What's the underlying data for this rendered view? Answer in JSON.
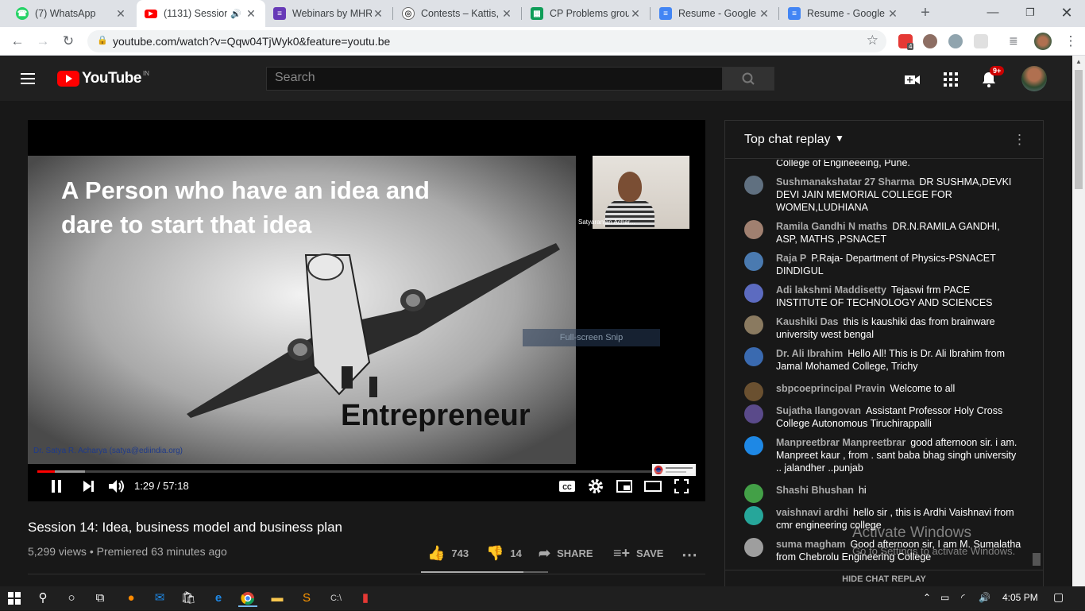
{
  "browser": {
    "tabs": [
      {
        "title": "(7) WhatsApp",
        "icon": "whatsapp-icon",
        "color": "#25d366",
        "active": false
      },
      {
        "title": "(1131) Session",
        "icon": "youtube-icon",
        "color": "#ff0000",
        "active": true
      },
      {
        "title": "Webinars by MHR",
        "icon": "forms-icon",
        "color": "#673ab7",
        "active": false
      },
      {
        "title": "Contests – Kattis,",
        "icon": "kattis-icon",
        "color": "#444444",
        "active": false
      },
      {
        "title": "CP Problems grou",
        "icon": "sheets-icon",
        "color": "#0f9d58",
        "active": false
      },
      {
        "title": "Resume - Google",
        "icon": "docs-icon",
        "color": "#4285f4",
        "active": false
      },
      {
        "title": "Resume - Google",
        "icon": "docs-icon",
        "color": "#4285f4",
        "active": false
      }
    ],
    "url": "youtube.com/watch?v=Qqw04TjWyk0&feature=youtu.be",
    "extension_badge": "4"
  },
  "youtube": {
    "logo_text": "YouTube",
    "country": "IN",
    "search_placeholder": "Search",
    "notification_count": "9+",
    "player": {
      "slide_title": "A Person who have an idea and dare to start that idea",
      "slide_word": "Entrepreneur",
      "slide_author": "Dr. Satya R. Acharya (satya@ediindia.org)",
      "camera_name": "Satyaranjan Achar...",
      "snip_label": "Full-screen Snip",
      "time": "1:29 / 57:18",
      "progress_played": 0.026,
      "progress_buffered": 0.072
    },
    "video": {
      "title": "Session 14: Idea, business model and business plan",
      "stats": "5,299 views • Premiered 63 minutes ago",
      "likes": "743",
      "dislikes": "14",
      "share_label": "SHARE",
      "save_label": "SAVE"
    },
    "chat": {
      "header": "Top chat replay",
      "footer": "HIDE CHAT REPLAY",
      "cut_text": "College of Engineeeing, Pune.",
      "messages": [
        {
          "author": "Sushmanakshatar 27 Sharma",
          "text": "DR SUSHMA,DEVKI DEVI JAIN MEMORIAL COLLEGE FOR WOMEN,LUDHIANA",
          "avatar_color": "#607080"
        },
        {
          "author": "Ramila Gandhi N maths",
          "text": "DR.N.RAMILA GANDHI, ASP, MATHS ,PSNACET",
          "avatar_color": "#a08070"
        },
        {
          "author": "Raja P",
          "text": "P.Raja- Department of Physics-PSNACET DINDIGUL",
          "avatar_color": "#4a7ab0"
        },
        {
          "author": "Adi lakshmi Maddisetty",
          "text": "Tejaswi frm PACE INSTITUTE OF TECHNOLOGY AND SCIENCES",
          "avatar_color": "#5c6bc0"
        },
        {
          "author": "Kaushiki Das",
          "text": "this is kaushiki das from brainware university west bengal",
          "avatar_color": "#8a7a60"
        },
        {
          "author": "Dr. Ali Ibrahim",
          "text": "Hello All! This is Dr. Ali Ibrahim from Jamal Mohamed College, Trichy",
          "avatar_color": "#3a6ab0"
        },
        {
          "author": "sbpcoeprincipal Pravin",
          "text": "Welcome to all",
          "avatar_color": "#6a5030"
        },
        {
          "author": "Sujatha Ilangovan",
          "text": "Assistant Professor Holy Cross College Autonomous Tiruchirappalli",
          "avatar_color": "#5a4a8a"
        },
        {
          "author": "Manpreetbrar Manpreetbrar",
          "text": "good afternoon sir. i am. Manpreet kaur , from . sant baba bhag singh university .. jalandher ..punjab",
          "avatar_color": "#1e88e5"
        },
        {
          "author": "Shashi Bhushan",
          "text": "hi",
          "avatar_color": "#43a047"
        },
        {
          "author": "vaishnavi ardhi",
          "text": "hello sir , this is Ardhi Vaishnavi from cmr engineering college",
          "avatar_color": "#26a69a"
        },
        {
          "author": "suma magham",
          "text": "Good afternoon sir, I am M. Sumalatha from Chebrolu Engineering College",
          "avatar_color": "#9e9e9e"
        }
      ]
    }
  },
  "watermark": {
    "line1": "Activate Windows",
    "line2": "Go to Settings to activate Windows."
  },
  "taskbar": {
    "time": "4:05 PM"
  }
}
